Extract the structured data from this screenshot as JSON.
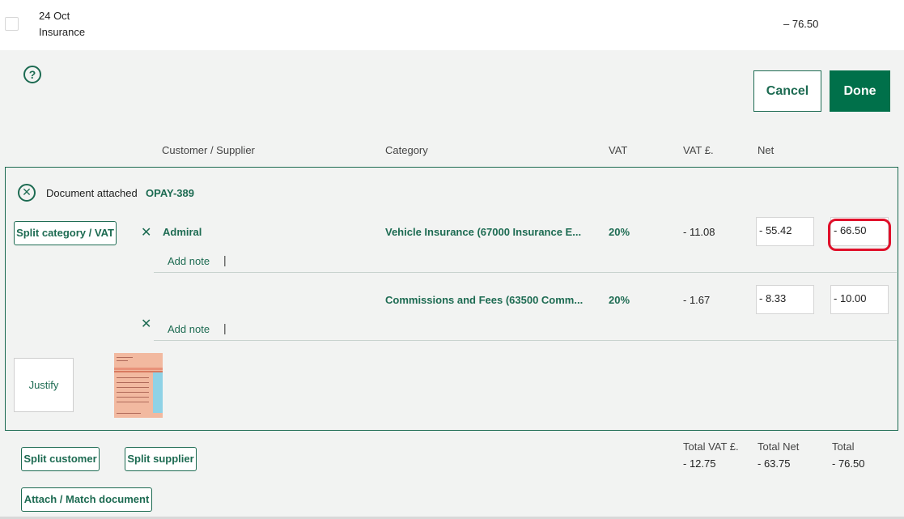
{
  "transaction": {
    "date": "24 Oct",
    "description": "Insurance",
    "amount": "– 76.50"
  },
  "help_icon_glyph": "?",
  "actions": {
    "cancel_label": "Cancel",
    "done_label": "Done"
  },
  "columns": {
    "customer_supplier": "Customer / Supplier",
    "category": "Category",
    "vat": "VAT",
    "vat_amount": "VAT £.",
    "net": "Net"
  },
  "document": {
    "label": "Document attached",
    "reference": "OPAY-389",
    "icon": "remove-circle-icon"
  },
  "split_category_label": "Split category / VAT",
  "rows": [
    {
      "supplier": "Admiral",
      "add_note": "Add note",
      "category": "Vehicle Insurance (67000 Insurance E...",
      "vat": "20%",
      "vat_amount": "- 11.08",
      "net": "- 55.42",
      "total": "- 66.50"
    },
    {
      "supplier": "",
      "add_note": "Add note",
      "category": "Commissions and Fees (63500 Comm...",
      "vat": "20%",
      "vat_amount": "- 1.67",
      "net": "- 8.33",
      "total": "- 10.00"
    }
  ],
  "remove_glyph": "✕",
  "justify_label": "Justify",
  "buttons": {
    "split_customer": "Split customer",
    "split_supplier": "Split supplier",
    "attach_match": "Attach / Match document"
  },
  "totals": {
    "vat_label": "Total VAT £.",
    "vat_value": "- 12.75",
    "net_label": "Total Net",
    "net_value": "- 63.75",
    "total_label": "Total",
    "total_value": "- 76.50"
  },
  "colors": {
    "accent": "#1d6b52",
    "primary_button": "#00704a",
    "highlight": "#e0102a",
    "background": "#f2f3f2"
  }
}
